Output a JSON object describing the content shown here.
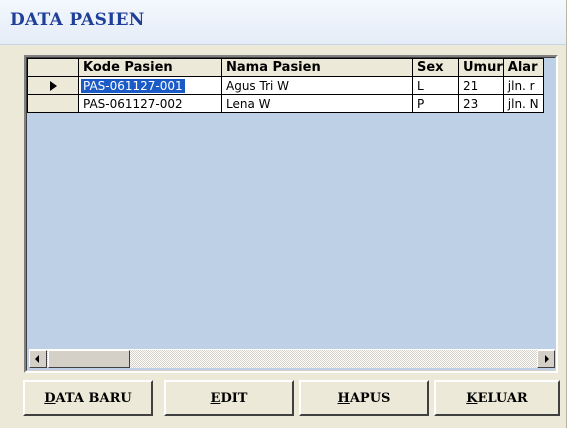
{
  "window": {
    "title": "DATA PASIEN"
  },
  "grid": {
    "columns": [
      "Kode Pasien",
      "Nama Pasien",
      "Sex",
      "Umur",
      "Alar"
    ],
    "rows": [
      {
        "kode": "PAS-061127-001",
        "nama": "Agus Tri W",
        "sex": "L",
        "umur": "21",
        "alamat": "jln. r"
      },
      {
        "kode": "PAS-061127-002",
        "nama": "Lena W",
        "sex": "P",
        "umur": "23",
        "alamat": "jln. N"
      }
    ],
    "selected_row": 0,
    "highlight_color": "#1a5bc8",
    "background_color": "#bed0e6"
  },
  "buttons": {
    "data_baru": {
      "accel": "D",
      "rest": "ATA BARU"
    },
    "edit": {
      "accel": "E",
      "rest": "DIT"
    },
    "hapus": {
      "accel": "H",
      "rest": "APUS"
    },
    "keluar": {
      "accel": "K",
      "rest": "ELUAR"
    }
  },
  "icons": [
    "row-selector-arrow-icon",
    "scroll-left-icon",
    "scroll-right-icon"
  ]
}
